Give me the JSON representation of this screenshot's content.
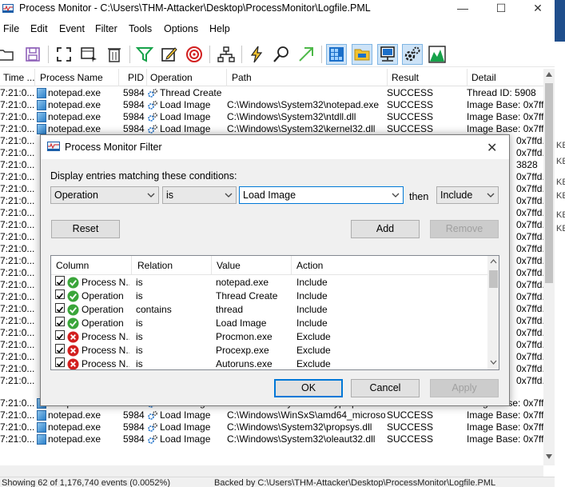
{
  "window": {
    "title": "Process Monitor - C:\\Users\\THM-Attacker\\Desktop\\ProcessMonitor\\Logfile.PML",
    "minimize": "—",
    "maximize": "☐",
    "close": "✕"
  },
  "menu": [
    "File",
    "Edit",
    "Event",
    "Filter",
    "Tools",
    "Options",
    "Help"
  ],
  "grid": {
    "columns": [
      "Time ...",
      "Process Name",
      "PID",
      "Operation",
      "Path",
      "Result",
      "Detail"
    ],
    "rows": [
      {
        "time": "7:21:0...",
        "process": "notepad.exe",
        "pid": "5984",
        "operation": "Thread Create",
        "path": "",
        "result": "SUCCESS",
        "detail": "Thread ID: 5908"
      },
      {
        "time": "7:21:0...",
        "process": "notepad.exe",
        "pid": "5984",
        "operation": "Load Image",
        "path": "C:\\Windows\\System32\\notepad.exe",
        "result": "SUCCESS",
        "detail": "Image Base: 0x7ff6..."
      },
      {
        "time": "7:21:0...",
        "process": "notepad.exe",
        "pid": "5984",
        "operation": "Load Image",
        "path": "C:\\Windows\\System32\\ntdll.dll",
        "result": "SUCCESS",
        "detail": "Image Base: 0x7ffd..."
      },
      {
        "time": "7:21:0...",
        "process": "notepad.exe",
        "pid": "5984",
        "operation": "Load Image",
        "path": "C:\\Windows\\System32\\kernel32.dll",
        "result": "SUCCESS",
        "detail": "Image Base: 0x7ffd..."
      }
    ],
    "hidden_rows_time": "7:21:0...",
    "partial_details": [
      "0x7ffd.",
      "0x7ffd.",
      "3828",
      "0x7ffd.",
      "0x7ffd.",
      "0x7ffd.",
      "0x7ffd.",
      "0x7ffd.",
      "0x7ffd.",
      "0x7ffd.",
      "0x7ffd.",
      "0x7ffd.",
      "0x7ffd.",
      "0x7ffd.",
      "0x7ffd.",
      "0x7ffd.",
      "0x7ffd.",
      "0x7ffd.",
      "0x7ffd.",
      "0x7ffd.",
      "0x7ffd."
    ],
    "bottom_rows": [
      {
        "time": "7:21:0...",
        "process": "notepad.exe",
        "pid": "5984",
        "operation": "Load Image",
        "path": "C:\\Windows\\System32\\cryptsp.dll",
        "result": "SUCCESS",
        "detail": "Image Base: 0x7ffd..."
      },
      {
        "time": "7:21:0...",
        "process": "notepad.exe",
        "pid": "5984",
        "operation": "Load Image",
        "path": "C:\\Windows\\WinSxS\\amd64_microsoft....",
        "result": "SUCCESS",
        "detail": "Image Base: 0x7ffc..."
      },
      {
        "time": "7:21:0...",
        "process": "notepad.exe",
        "pid": "5984",
        "operation": "Load Image",
        "path": "C:\\Windows\\System32\\propsys.dll",
        "result": "SUCCESS",
        "detail": "Image Base: 0x7ffd..."
      },
      {
        "time": "7:21:0...",
        "process": "notepad.exe",
        "pid": "5984",
        "operation": "Load Image",
        "path": "C:\\Windows\\System32\\oleaut32.dll",
        "result": "SUCCESS",
        "detail": "Image Base: 0x7ffd..."
      }
    ]
  },
  "right_strip": [
    "KE",
    "KE",
    "KE",
    "KE",
    "KE",
    "KE"
  ],
  "status": {
    "events": "Showing 62 of 1,176,740 events (0.0052%)",
    "backed": "Backed by C:\\Users\\THM-Attacker\\Desktop\\ProcessMonitor\\Logfile.PML"
  },
  "dialog": {
    "title": "Process Monitor Filter",
    "prompt": "Display entries matching these conditions:",
    "column_value": "Operation",
    "relation_value": "is",
    "value_value": "Load Image",
    "then_label": "then",
    "action_value": "Include",
    "reset": "Reset",
    "add": "Add",
    "remove": "Remove",
    "ok": "OK",
    "cancel": "Cancel",
    "apply": "Apply",
    "list_columns": [
      "Column",
      "Relation",
      "Value",
      "Action"
    ],
    "filters": [
      {
        "column": "Process N...",
        "relation": "is",
        "value": "notepad.exe",
        "action": "Include",
        "type": "include"
      },
      {
        "column": "Operation",
        "relation": "is",
        "value": "Thread Create",
        "action": "Include",
        "type": "include"
      },
      {
        "column": "Operation",
        "relation": "contains",
        "value": "thread",
        "action": "Include",
        "type": "include"
      },
      {
        "column": "Operation",
        "relation": "is",
        "value": "Load Image",
        "action": "Include",
        "type": "include"
      },
      {
        "column": "Process N...",
        "relation": "is",
        "value": "Procmon.exe",
        "action": "Exclude",
        "type": "exclude"
      },
      {
        "column": "Process N...",
        "relation": "is",
        "value": "Procexp.exe",
        "action": "Exclude",
        "type": "exclude"
      },
      {
        "column": "Process N...",
        "relation": "is",
        "value": "Autoruns.exe",
        "action": "Exclude",
        "type": "exclude"
      }
    ]
  },
  "colors": {
    "include": "#3aa53a",
    "exclude": "#d22020",
    "accent": "#0078d7"
  }
}
